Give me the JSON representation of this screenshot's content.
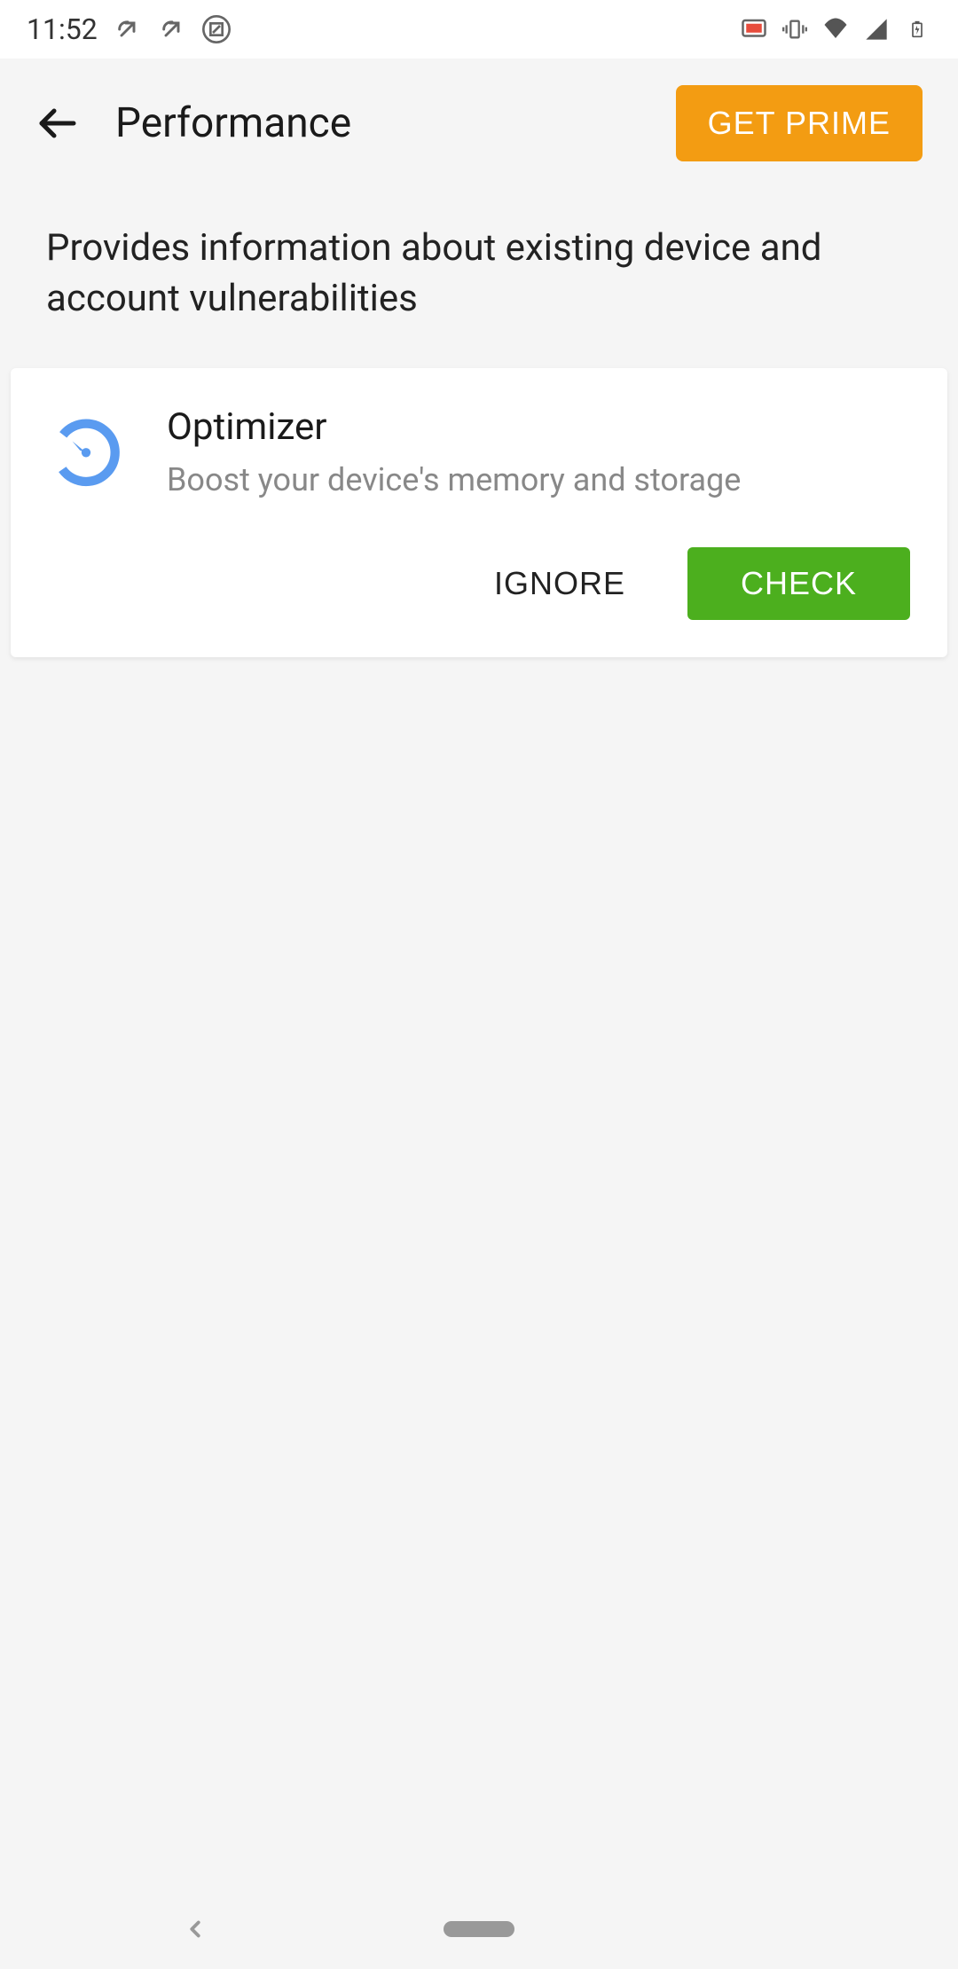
{
  "status_bar": {
    "time": "11:52"
  },
  "header": {
    "title": "Performance",
    "prime_label": "GET PRIME"
  },
  "description": "Provides information about existing device and account vulnerabilities",
  "card": {
    "title": "Optimizer",
    "subtitle": "Boost your device's memory and storage",
    "ignore_label": "IGNORE",
    "check_label": "CHECK"
  },
  "colors": {
    "prime_bg": "#f39c12",
    "check_bg": "#4caf1e",
    "icon_blue": "#5a9bf0"
  }
}
